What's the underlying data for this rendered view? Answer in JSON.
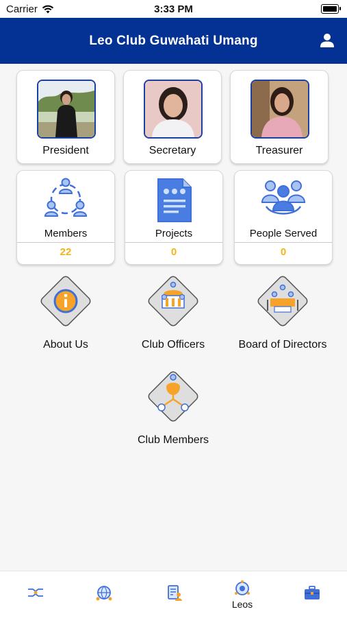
{
  "status_bar": {
    "carrier": "Carrier",
    "time": "3:33 PM"
  },
  "header": {
    "title": "Leo Club Guwahati Umang"
  },
  "officers": [
    {
      "label": "President"
    },
    {
      "label": "Secretary"
    },
    {
      "label": "Treasurer"
    }
  ],
  "stats": [
    {
      "label": "Members",
      "value": "22"
    },
    {
      "label": "Projects",
      "value": "0"
    },
    {
      "label": "People Served",
      "value": "0"
    }
  ],
  "menu": [
    {
      "label": "About Us"
    },
    {
      "label": "Club Officers"
    },
    {
      "label": "Board of Directors"
    },
    {
      "label": "Club Members"
    }
  ],
  "tab_bar": {
    "active_label": "Leos"
  },
  "colors": {
    "header": "#033294",
    "accent": "#f3b416",
    "icon_blue": "#3f6fd8"
  }
}
